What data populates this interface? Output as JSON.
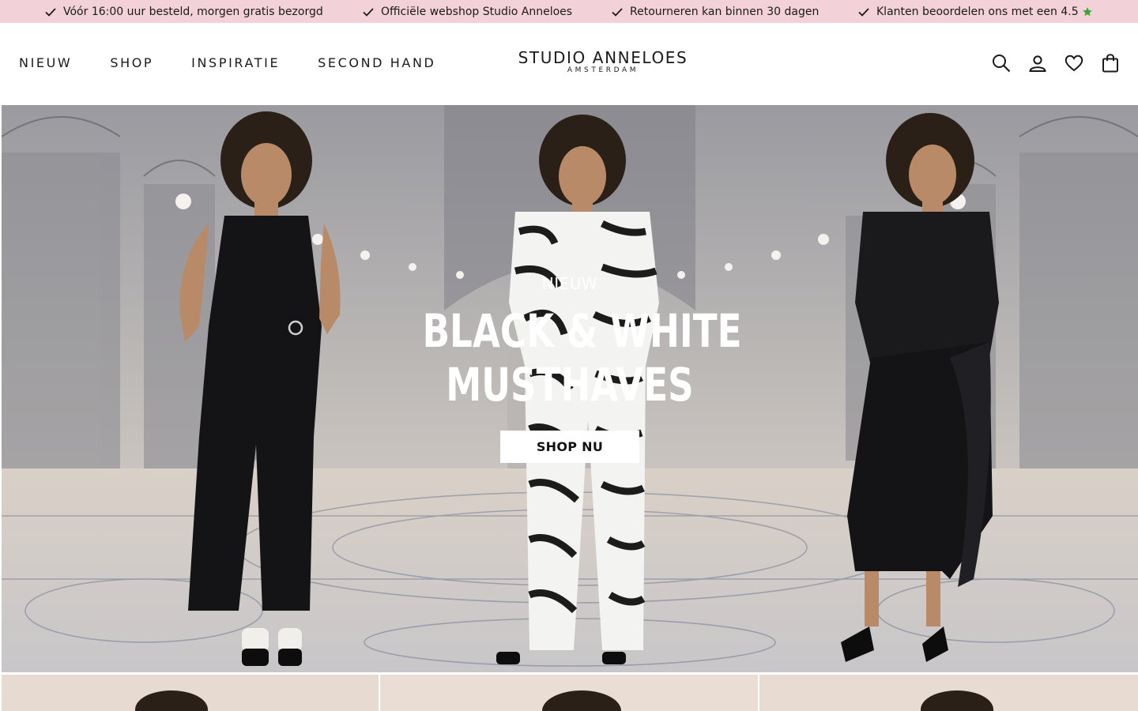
{
  "usp_bar": {
    "items": [
      "Vóór 16:00 uur besteld, morgen gratis bezorgd",
      "Officiële webshop Studio Anneloes",
      "Retourneren kan binnen 30 dagen",
      "Klanten beoordelen ons met een 4.5"
    ],
    "background": "#f2d2d8",
    "star_color": "#3aa635"
  },
  "header": {
    "nav": [
      "NIEUW",
      "SHOP",
      "INSPIRATIE",
      "SECOND HAND"
    ],
    "logo": {
      "main": "STUDIO ANNELOES",
      "sub": "AMSTERDAM"
    },
    "icons": [
      "search-icon",
      "account-icon",
      "wishlist-heart-icon",
      "shopping-bag-icon"
    ]
  },
  "hero": {
    "kicker": "NIEUW",
    "title_line1": "BLACK & WHITE",
    "title_line2": "MUSTHAVES",
    "cta": "SHOP NU"
  }
}
